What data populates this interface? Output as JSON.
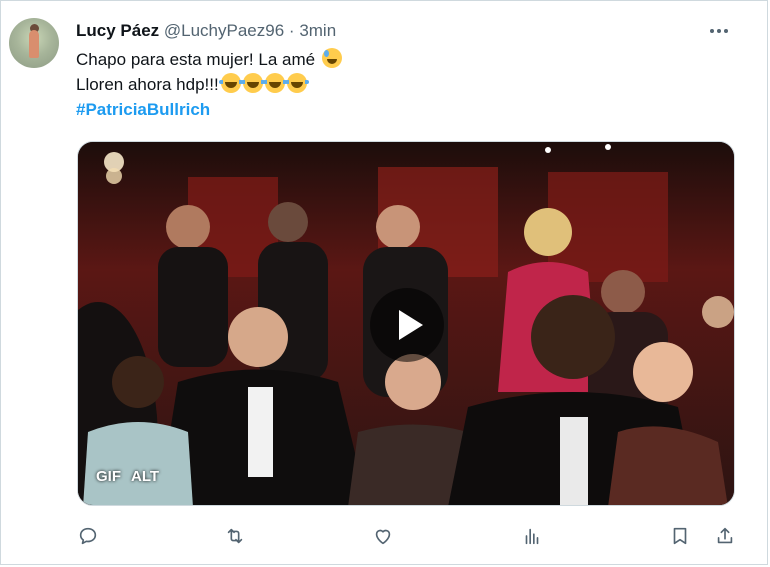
{
  "tweet": {
    "author_name": "Lucy Páez",
    "handle": "@LuchyPaez96",
    "separator": "·",
    "time": "3min",
    "line1": "Chapo para esta mujer! La amé",
    "line2": "Lloren ahora hdp!!!",
    "hashtag": "#PatriciaBullrich"
  },
  "media": {
    "gif_label": "GIF",
    "alt_label": "ALT"
  },
  "icons": {
    "more": "more-icon",
    "reply": "reply-icon",
    "retweet": "retweet-icon",
    "like": "heart-icon",
    "views": "views-icon",
    "bookmark": "bookmark-icon",
    "share": "share-icon"
  },
  "colors": {
    "link": "#1d9bf0",
    "secondary": "#536471",
    "text": "#0f1419"
  }
}
